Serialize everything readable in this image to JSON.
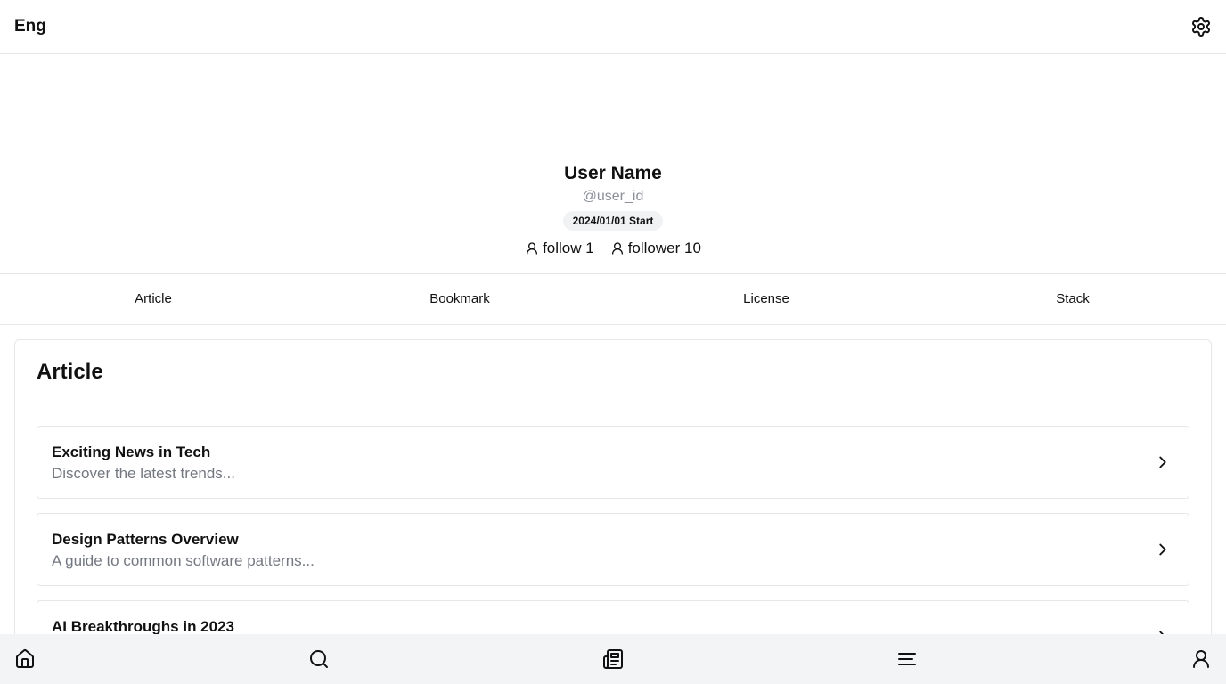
{
  "header": {
    "language_label": "Eng",
    "settings_icon": "gear-icon"
  },
  "profile": {
    "name": "User Name",
    "handle": "@user_id",
    "start_badge": "2024/01/01 Start",
    "follow_label": "follow 1",
    "follower_label": "follower 10"
  },
  "tabs": [
    {
      "label": "Article"
    },
    {
      "label": "Bookmark"
    },
    {
      "label": "License"
    },
    {
      "label": "Stack"
    }
  ],
  "article_section": {
    "heading": "Article",
    "items": [
      {
        "title": "Exciting News in Tech",
        "description": "Discover the latest trends..."
      },
      {
        "title": "Design Patterns Overview",
        "description": "A guide to common software patterns..."
      },
      {
        "title": "AI Breakthroughs in 2023",
        "description": ""
      }
    ]
  },
  "bottom_nav": {
    "items": [
      {
        "icon": "home-icon"
      },
      {
        "icon": "search-icon"
      },
      {
        "icon": "newspaper-icon"
      },
      {
        "icon": "menu-icon"
      },
      {
        "icon": "user-icon"
      }
    ]
  }
}
